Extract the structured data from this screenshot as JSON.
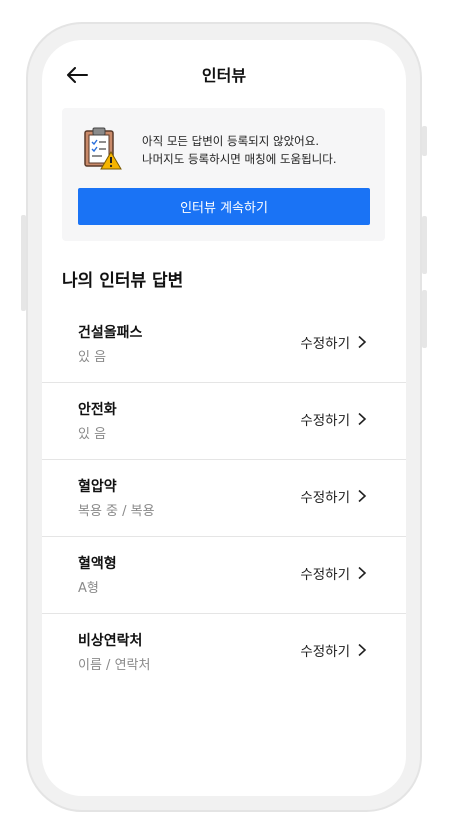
{
  "header": {
    "title": "인터뷰"
  },
  "notice": {
    "line1": "아직 모든 답변이 등록되지 않았어요.",
    "line2": "나머지도 등록하시면 매칭에 도움됩니다.",
    "button_label": "인터뷰 계속하기"
  },
  "section": {
    "title": "나의 인터뷰 답변"
  },
  "edit_label": "수정하기",
  "answers": [
    {
      "title": "건설올패스",
      "value": "있 음"
    },
    {
      "title": "안전화",
      "value": "있 음"
    },
    {
      "title": "혈압약",
      "value": "복용 중 / 복용"
    },
    {
      "title": "혈액형",
      "value": "A형"
    },
    {
      "title": "비상연락처",
      "value": "이름 / 연락처"
    }
  ],
  "colors": {
    "primary": "#1a73f5",
    "card_bg": "#f6f6f7",
    "muted": "#8a8a8a"
  },
  "icons": {
    "back": "arrow-left-icon",
    "notice": "clipboard-warning-icon",
    "chevron": "chevron-right-icon"
  }
}
